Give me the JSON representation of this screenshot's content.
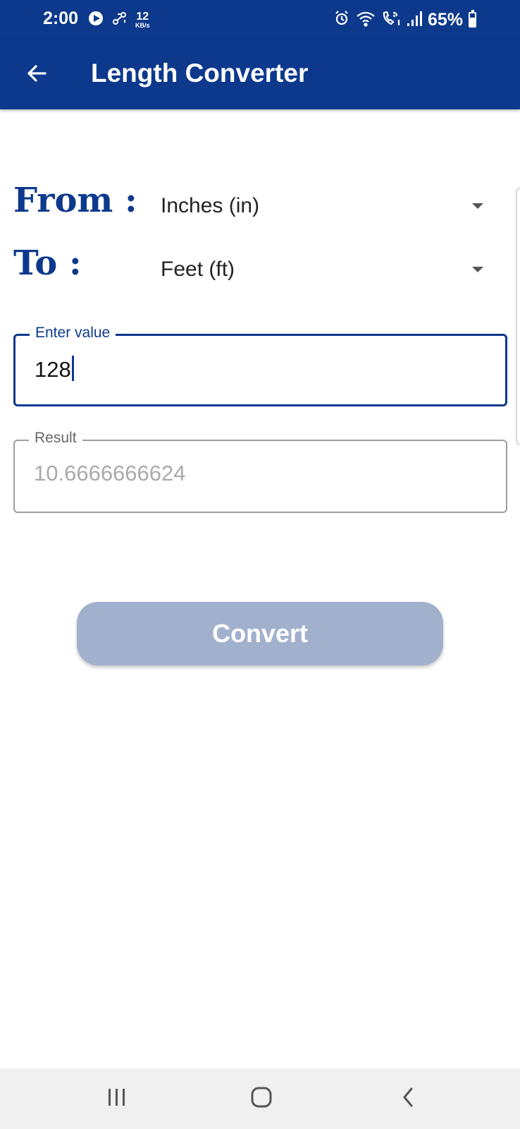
{
  "status_bar": {
    "time": "2:00",
    "net_speed_value": "12",
    "net_speed_unit": "KB/s",
    "battery_percent": "65%",
    "battery_level": 0.65,
    "icons": [
      "media-play-icon",
      "link-icon",
      "alarm-icon",
      "wifi-icon",
      "wifi-calling-icon",
      "signal-icon",
      "battery-icon"
    ]
  },
  "app_bar": {
    "title": "Length Converter",
    "back_icon": "arrow-left-icon"
  },
  "form": {
    "from_label": "From :",
    "from_value": "Inches (in)",
    "to_label": "To :",
    "to_value": "Feet (ft)",
    "input_label": "Enter value",
    "input_value": "128",
    "result_label": "Result",
    "result_value": "10.6666666624"
  },
  "convert_button": {
    "label": "Convert"
  },
  "nav_bar": {
    "icons": [
      "recent-apps-icon",
      "home-icon",
      "back-icon"
    ]
  },
  "colors": {
    "primary": "#0d398c",
    "button_disabled": "#a1b1cd",
    "nav_bg": "#f0f0f0"
  }
}
